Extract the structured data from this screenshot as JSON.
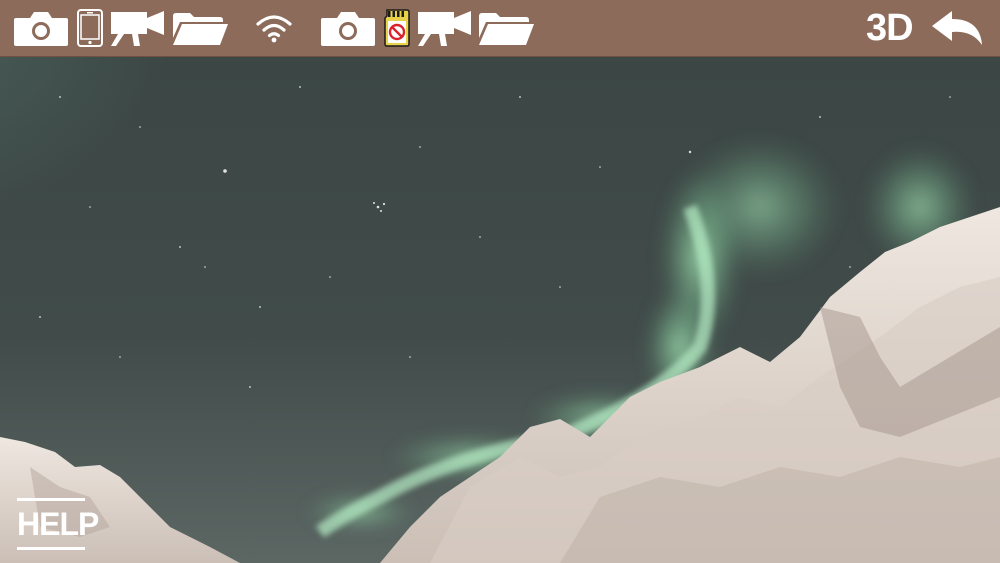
{
  "toolbar": {
    "group_left": [
      "camera-icon",
      "phone-icon",
      "video-camera-icon",
      "folder-icon"
    ],
    "center_icon": "wifi-icon",
    "group_right": [
      "camera-icon",
      "sd-card-no-icon",
      "video-camera-icon",
      "folder-icon"
    ],
    "mode_label": "3D",
    "back_icon": "back-arrow-icon"
  },
  "help": {
    "label": "HELP"
  },
  "colors": {
    "toolbar_bg": "#8d6b5a",
    "icon": "#ffffff",
    "aurora": "#8fd2a3",
    "sky": "#38403d",
    "snow": "#e6dcd3"
  }
}
